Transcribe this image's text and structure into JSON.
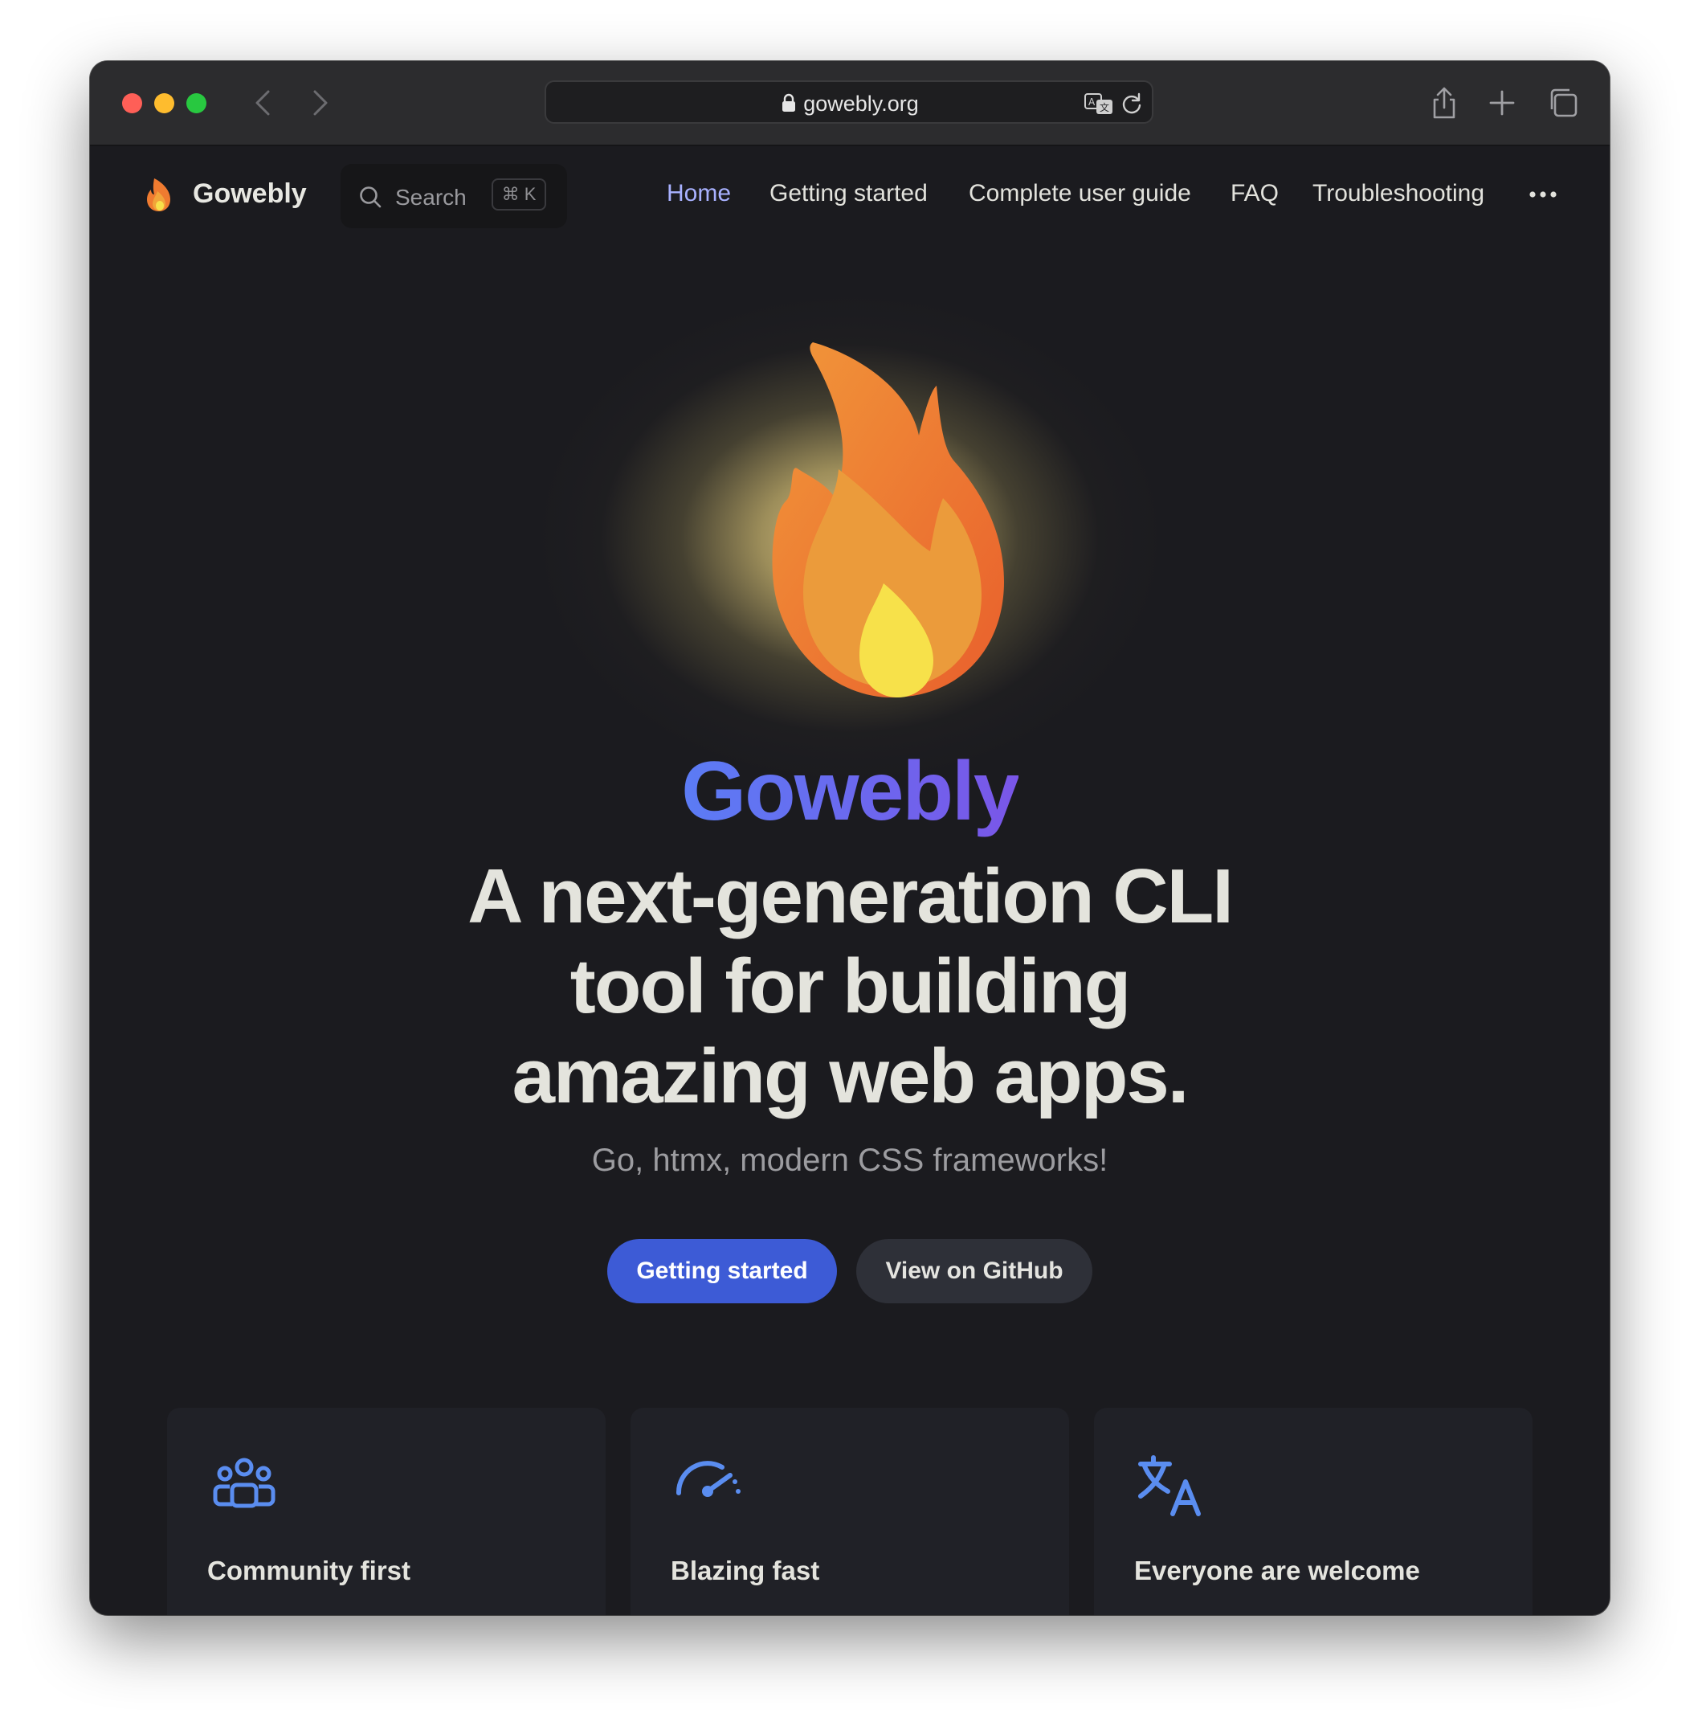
{
  "browser": {
    "url": "gowebly.org"
  },
  "header": {
    "brand": "Gowebly",
    "search": {
      "label": "Search",
      "shortcut": "⌘ K"
    },
    "nav": [
      "Home",
      "Getting started",
      "Complete user guide",
      "FAQ",
      "Troubleshooting"
    ],
    "active_nav": "Home"
  },
  "hero": {
    "name": "Gowebly",
    "tagline": "A next-generation CLI tool for building amazing web apps.",
    "subtitle": "Go, htmx, modern CSS frameworks!",
    "primary_button": "Getting started",
    "secondary_button": "View on GitHub"
  },
  "features": [
    {
      "icon": "community-icon",
      "title": "Community first"
    },
    {
      "icon": "speedometer-icon",
      "title": "Blazing fast"
    },
    {
      "icon": "translate-icon",
      "title": "Everyone are welcome"
    }
  ],
  "colors": {
    "accent": "#3d5bd6",
    "nav_active": "#a8b1ff",
    "icon_blue": "#5a8df0",
    "background": "#1b1b1f"
  }
}
